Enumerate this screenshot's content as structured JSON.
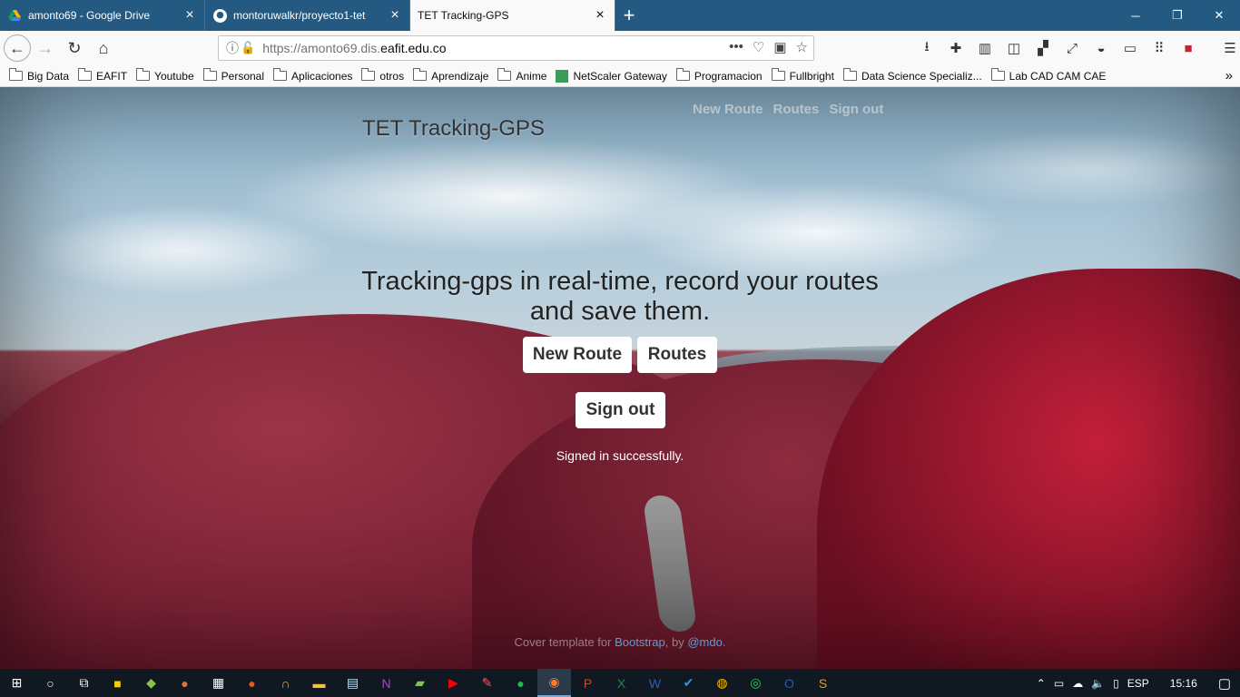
{
  "browser": {
    "tabs": [
      {
        "title": "amonto69 - Google Drive",
        "icon": "google-drive-icon",
        "active": false
      },
      {
        "title": "montoruwalkr/proyecto1-tet",
        "icon": "github-icon",
        "active": false
      },
      {
        "title": "TET Tracking-GPS",
        "icon": "page-icon",
        "active": true
      }
    ],
    "url": {
      "prefix": "https://amonto69.dis.",
      "host": "eafit.edu.co"
    },
    "bookmarks": [
      "Big Data",
      "EAFIT",
      "Youtube",
      "Personal",
      "Aplicaciones",
      "otros",
      "Aprendizaje",
      "Anime",
      "NetScaler Gateway",
      "Programacion",
      "Fullbright",
      "Data Science Specializ...",
      "Lab CAD CAM CAE"
    ]
  },
  "page": {
    "brand": "TET Tracking-GPS",
    "nav": {
      "new_route": "New Route",
      "routes": "Routes",
      "sign_out": "Sign out"
    },
    "headline": "Tracking-gps in real-time, record your routes and save them.",
    "buttons": {
      "new_route": "New Route",
      "routes": "Routes",
      "sign_out": "Sign out"
    },
    "flash": "Signed in successfully.",
    "footer": {
      "text_before": "Cover template for ",
      "link1": "Bootstrap",
      "text_middle": ", by ",
      "link2": "@mdo",
      "text_after": "."
    }
  },
  "taskbar": {
    "language": "ESP",
    "time": "15:16"
  }
}
